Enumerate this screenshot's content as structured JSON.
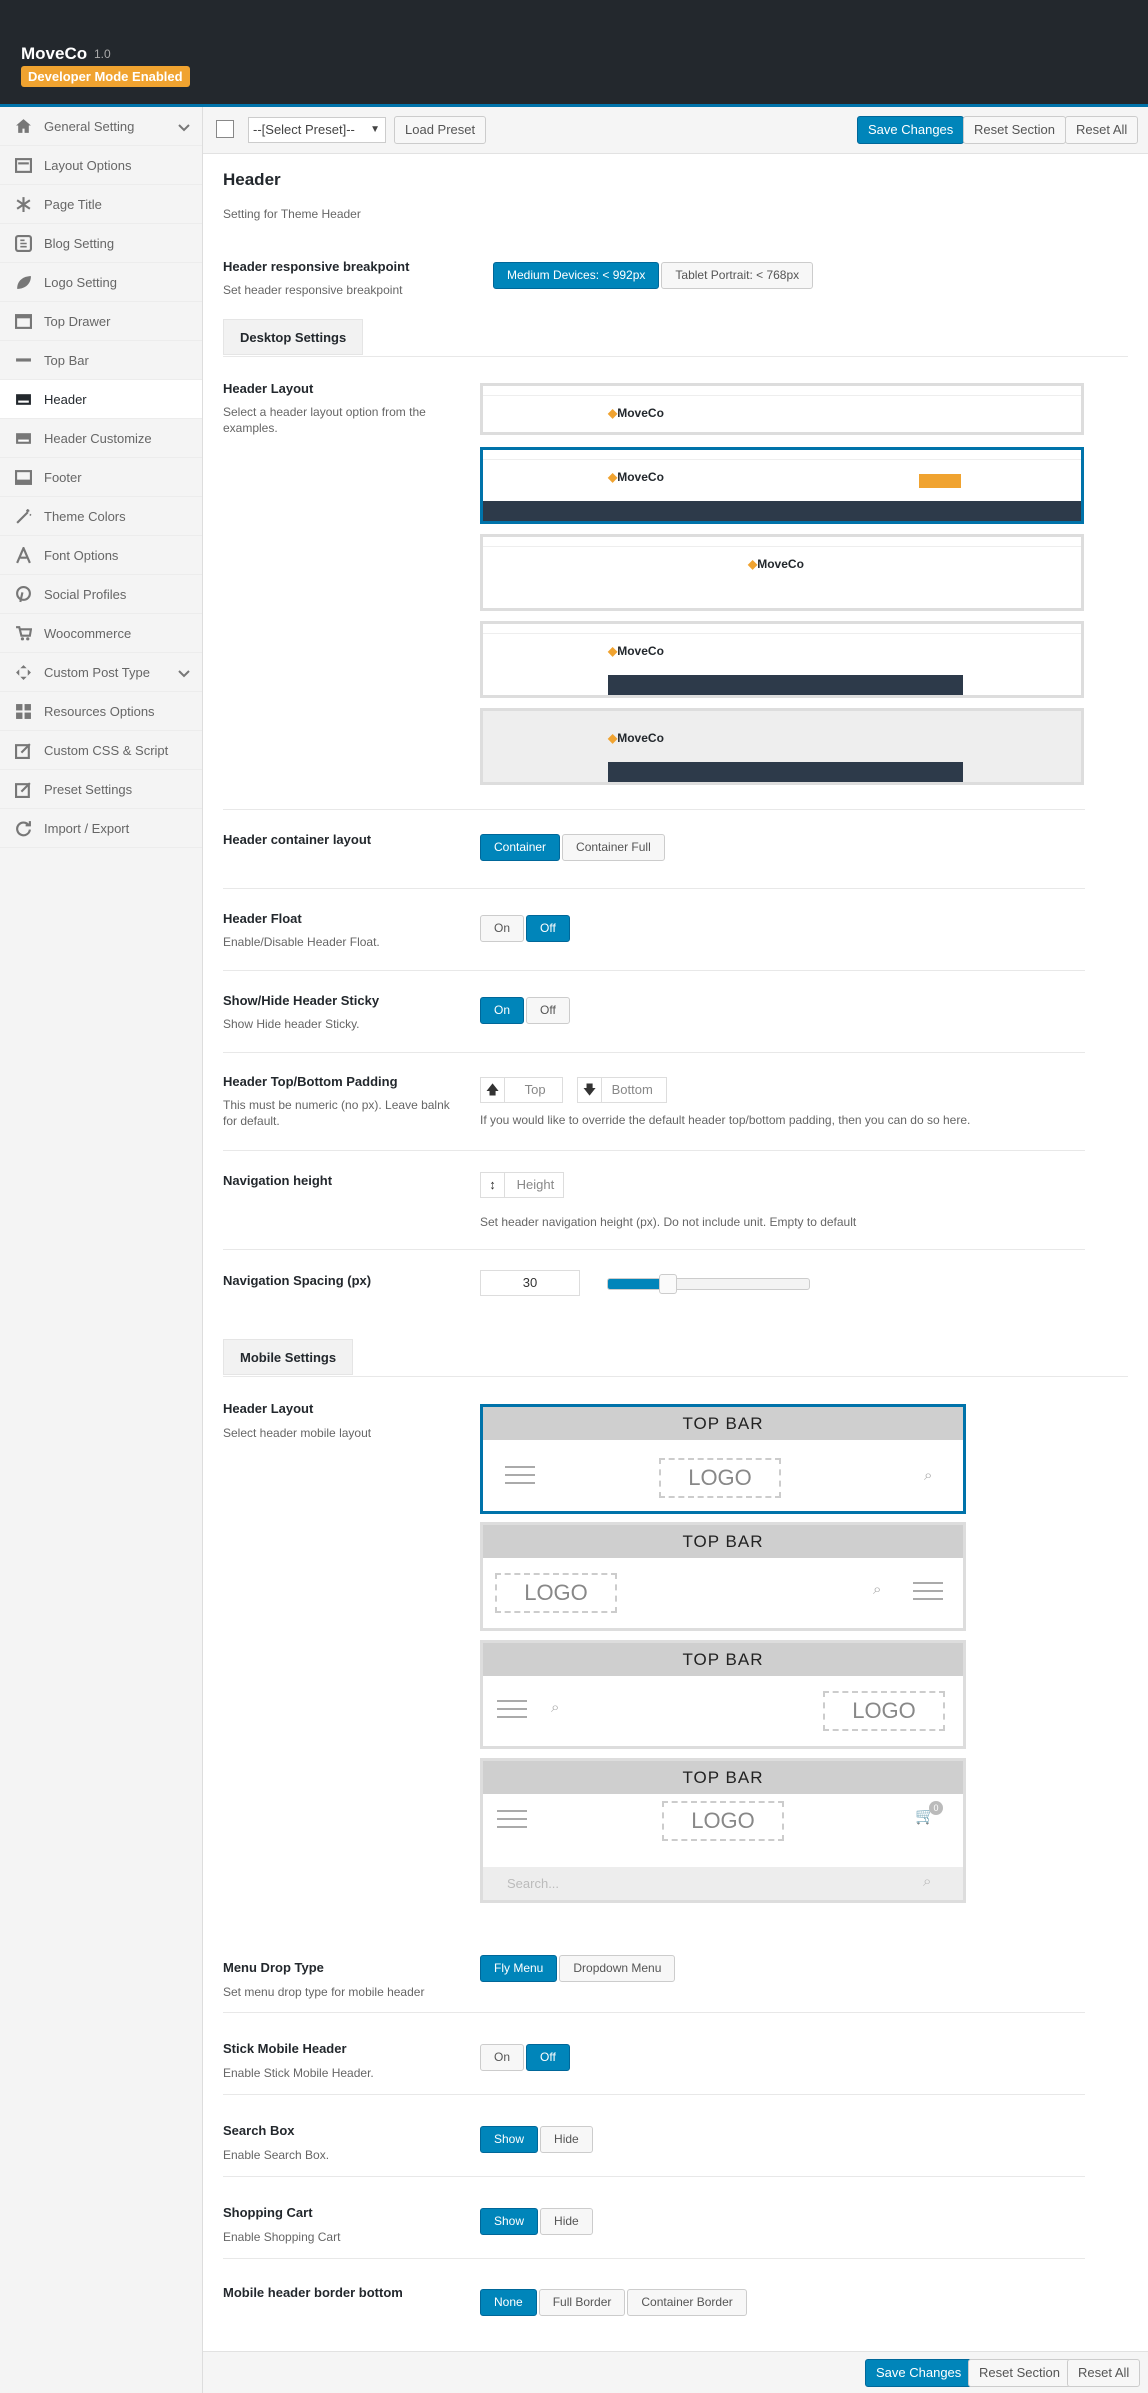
{
  "app": {
    "title": "MoveCo",
    "version": "1.0",
    "badge": "Developer Mode Enabled"
  },
  "sidebar": {
    "items": [
      {
        "label": "General Setting",
        "icon": "home-icon"
      },
      {
        "label": "Layout Options",
        "icon": "layout-icon"
      },
      {
        "label": "Page Title",
        "icon": "asterisk-icon"
      },
      {
        "label": "Blog Setting",
        "icon": "blog-icon"
      },
      {
        "label": "Logo Setting",
        "icon": "leaf-icon"
      },
      {
        "label": "Top Drawer",
        "icon": "drawer-icon"
      },
      {
        "label": "Top Bar",
        "icon": "minus-icon"
      },
      {
        "label": "Header",
        "icon": "header-card-icon"
      },
      {
        "label": "Header Customize",
        "icon": "header-customize-icon"
      },
      {
        "label": "Footer",
        "icon": "footer-icon"
      },
      {
        "label": "Theme Colors",
        "icon": "magic-wand-icon"
      },
      {
        "label": "Font Options",
        "icon": "font-icon"
      },
      {
        "label": "Social Profiles",
        "icon": "pinterest-icon"
      },
      {
        "label": "Woocommerce",
        "icon": "cart-icon"
      },
      {
        "label": "Custom Post Type",
        "icon": "crosshair-icon"
      },
      {
        "label": "Resources Options",
        "icon": "grid-icon"
      },
      {
        "label": "Custom CSS & Script",
        "icon": "edit-icon"
      },
      {
        "label": "Preset Settings",
        "icon": "edit-icon"
      },
      {
        "label": "Import / Export",
        "icon": "refresh-icon"
      }
    ]
  },
  "toolbar": {
    "preset_select": "--[Select Preset]--",
    "load_preset": "Load Preset",
    "save": "Save Changes",
    "reset_section": "Reset Section",
    "reset_all": "Reset All"
  },
  "section": {
    "title": "Header",
    "subtitle": "Setting for Theme Header"
  },
  "breakpoint": {
    "label": "Header responsive breakpoint",
    "desc": "Set header responsive breakpoint",
    "options": [
      "Medium Devices: < 992px",
      "Tablet Portrait: < 768px"
    ]
  },
  "desktop": {
    "tab": "Desktop Settings",
    "layout_label": "Header Layout",
    "layout_desc": "Select a header layout option from the examples.",
    "thumb_logo": "MoveCo",
    "container_label": "Header container layout",
    "container_options": [
      "Container",
      "Container Full"
    ],
    "float_label": "Header Float",
    "float_desc": "Enable/Disable Header Float.",
    "sticky_label": "Show/Hide Header Sticky",
    "sticky_desc": "Show Hide header Sticky.",
    "padding_label": "Header Top/Bottom Padding",
    "padding_desc": "This must be numeric (no px). Leave balnk for default.",
    "padding_top": "Top",
    "padding_bottom": "Bottom",
    "padding_help": "If you would like to override the default header top/bottom padding, then you can do so here.",
    "navheight_label": "Navigation height",
    "navheight_placeholder": "Height",
    "navheight_help": "Set header navigation height (px). Do not include unit. Empty to default",
    "navspacing_label": "Navigation Spacing (px)",
    "navspacing_value": "30",
    "navspacing_fill_percent": 30
  },
  "onoff": [
    "On",
    "Off"
  ],
  "mobile": {
    "tab": "Mobile Settings",
    "layout_label": "Header Layout",
    "layout_desc": "Select header mobile layout",
    "topbar_text": "TOP  BAR",
    "logo_text": "LOGO",
    "search_placeholder": "Search...",
    "cart_count": "0",
    "drop_label": "Menu Drop Type",
    "drop_desc": "Set menu drop type for mobile header",
    "drop_options": [
      "Fly Menu",
      "Dropdown Menu"
    ],
    "stick_label": "Stick Mobile Header",
    "stick_desc": "Enable Stick Mobile Header.",
    "search_label": "Search Box",
    "search_desc": "Enable Search Box.",
    "cart_label": "Shopping Cart",
    "cart_desc": "Enable Shopping Cart",
    "showhide": [
      "Show",
      "Hide"
    ],
    "border_label": "Mobile header border bottom",
    "border_options": [
      "None",
      "Full Border",
      "Container Border"
    ]
  },
  "colors": {
    "accent": "#0085ba",
    "badge": "#f0a330",
    "dark": "#23282d",
    "logo_orange": "#f0a330"
  }
}
